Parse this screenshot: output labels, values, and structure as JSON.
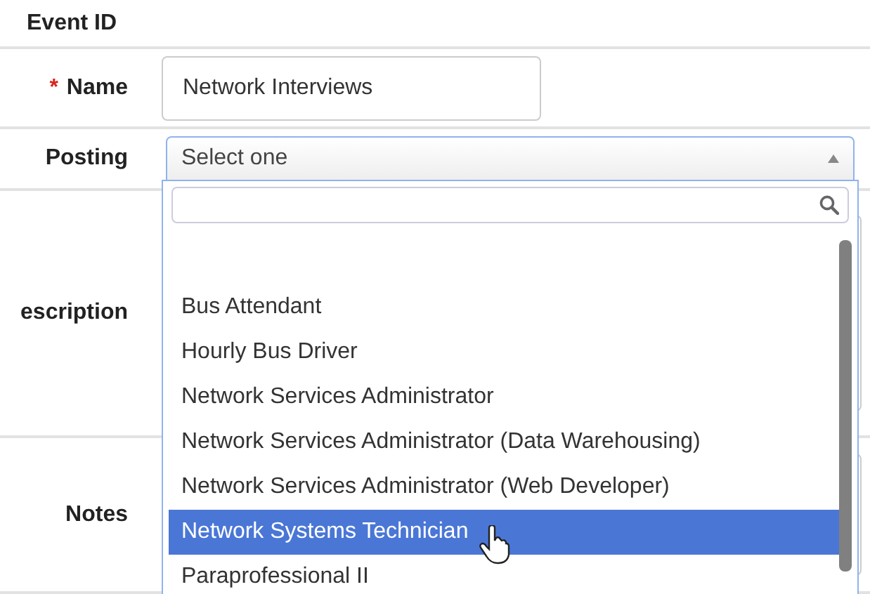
{
  "form": {
    "rows": [
      {
        "kind": "text",
        "label": "Event ID"
      },
      {
        "kind": "input",
        "label": "Name",
        "required_mark": "*",
        "value": "Network Interviews"
      },
      {
        "kind": "select",
        "label": "Posting",
        "value": "Select one",
        "expanded": true
      },
      {
        "kind": "area",
        "label": "escription"
      },
      {
        "kind": "area",
        "label": "Notes"
      }
    ]
  },
  "dropdown": {
    "options": [
      {
        "label": "Bus Attendant",
        "selected": false
      },
      {
        "label": "Hourly Bus Driver",
        "selected": false
      },
      {
        "label": "Network Services Administrator",
        "selected": false
      },
      {
        "label": "Network Services Administrator (Data Warehousing)",
        "selected": false
      },
      {
        "label": "Network Services Administrator (Web Developer)",
        "selected": false
      },
      {
        "label": "Network Systems Technician",
        "selected": true
      },
      {
        "label": "Paraprofessional II",
        "selected": false
      }
    ]
  }
}
